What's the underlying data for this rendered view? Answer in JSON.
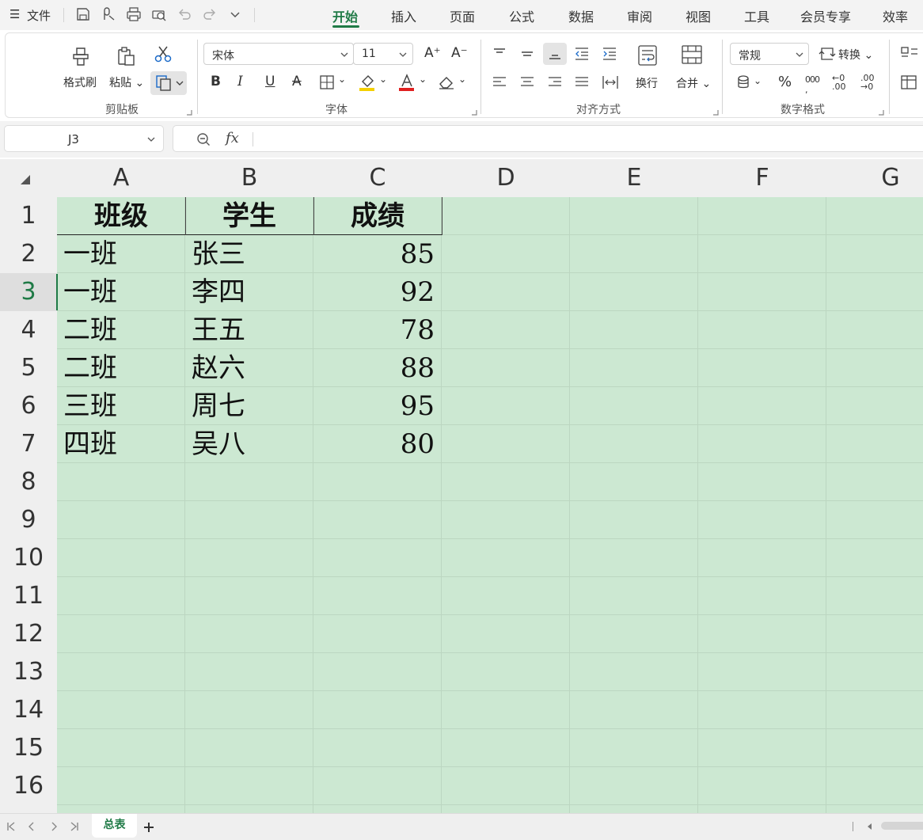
{
  "menu": {
    "hamburger_icon": "menu-icon",
    "file_label": "文件"
  },
  "ribbon_tabs": [
    {
      "label": "开始",
      "active": true
    },
    {
      "label": "插入"
    },
    {
      "label": "页面"
    },
    {
      "label": "公式"
    },
    {
      "label": "数据"
    },
    {
      "label": "审阅"
    },
    {
      "label": "视图"
    },
    {
      "label": "工具"
    },
    {
      "label": "会员专享"
    },
    {
      "label": "效率"
    }
  ],
  "clipboard": {
    "format_painter": "格式刷",
    "paste": "粘贴",
    "group": "剪贴板"
  },
  "font": {
    "name": "宋体",
    "size": "11",
    "group": "字体"
  },
  "alignment": {
    "wrap": "换行",
    "merge": "合并",
    "group": "对齐方式"
  },
  "number": {
    "format": "常规",
    "convert": "转换",
    "percent": "%",
    "group": "数字格式"
  },
  "formula_bar": {
    "cell_ref": "J3",
    "fx": "fx"
  },
  "sheet": {
    "columns": [
      "A",
      "B",
      "C",
      "D",
      "E",
      "F",
      "G"
    ],
    "rows": [
      "1",
      "2",
      "3",
      "4",
      "5",
      "6",
      "7",
      "8",
      "9",
      "10",
      "11",
      "12",
      "13",
      "14",
      "15",
      "16"
    ],
    "selected_row": "3",
    "header": [
      "班级",
      "学生",
      "成绩"
    ],
    "data": [
      [
        "一班",
        "张三",
        "85"
      ],
      [
        "一班",
        "李四",
        "92"
      ],
      [
        "二班",
        "王五",
        "78"
      ],
      [
        "二班",
        "赵六",
        "88"
      ],
      [
        "三班",
        "周七",
        "95"
      ],
      [
        "四班",
        "吴八",
        "80"
      ]
    ]
  },
  "sheet_tabs": {
    "active": "总表",
    "add_icon": "plus-icon"
  },
  "colors": {
    "accent": "#1f7a46",
    "grid_fill": "#cce8d2",
    "font_red": "#e02020",
    "highlight_yellow": "#f4d000"
  }
}
